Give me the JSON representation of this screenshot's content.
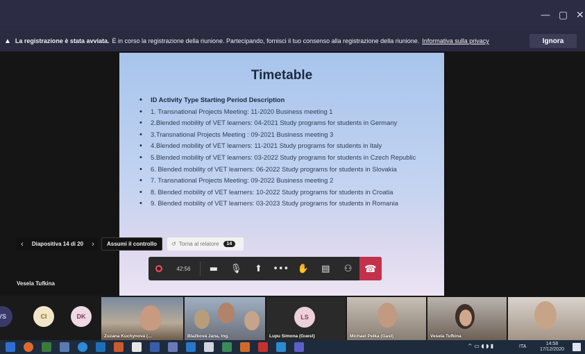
{
  "window": {
    "controls": [
      "—",
      "▢",
      "✕"
    ]
  },
  "banner": {
    "bold_text": "La registrazione è stata avviata.",
    "text": "È in corso la registrazione della riunione. Partecipando, fornisci il tuo consenso alla registrazione della riunione.",
    "link": "Informativa sulla privacy",
    "dismiss_label": "Ignora"
  },
  "slide": {
    "title": "Timetable",
    "items": [
      "ID Activity Type                        Starting Period  Description",
      "1. Transnational Projects Meeting:        11-2020 Business meeting 1",
      "2.Blended mobility of VET learners:     04-2021 Study programs for students in Germany",
      "3.Transnational Projects Meeting :      09-2021 Business meeting 3",
      "4.Blended mobility of VET learners:     11-2021 Study programs for students in Italy",
      "5.Blended mobility of VET learners:     03-2022 Study programs for students in Czech Republic",
      "6. Blended mobility of VET learners:     06-2022 Study programs for students in Slovakia",
      "7. Transnational Projects Meeting:        09-2022 Business meeting 2",
      "8. Blended mobility of VET learners:     10-2022 Study programs for students in Croatia",
      "9. Blended mobility of VET learners:     03-2023 Study programs for students in Romania"
    ]
  },
  "slide_nav": {
    "prev": "‹",
    "label": "Diapositiva 14 di 20",
    "next": "›",
    "take_control": "Assumi il controllo",
    "lower_hand": "Torna al relatore",
    "lower_hand_badge": "14"
  },
  "presenter": {
    "name": "Vesela Tufkina"
  },
  "callbar": {
    "timer": "42:56",
    "icons": [
      "camera-icon",
      "microphone-icon",
      "share-screen-icon",
      "more-icon",
      "raise-hand-icon",
      "chat-icon",
      "participants-icon",
      "hang-up-icon"
    ],
    "hang_up_color": "#c4314b"
  },
  "participants": {
    "avatars": [
      {
        "initials": "VS",
        "bg": "#3a3a6a",
        "fg": "#c9c9f0"
      },
      {
        "initials": "CI",
        "bg": "#f3e6c8",
        "fg": "#8a6a2a"
      },
      {
        "initials": "DK",
        "bg": "#eed9e4",
        "fg": "#7a3b5a"
      },
      {
        "initials": "LS",
        "bg": "#ecd0da",
        "fg": "#8a3b57"
      }
    ],
    "tiles": [
      {
        "name": "Zuzana Kuchynová (..."
      },
      {
        "name": "Blažková Jana, Ing."
      },
      {
        "name": "Lupu Simona (Guest)"
      },
      {
        "name": "Michael Pelka (Gast)"
      },
      {
        "name": "Vesela Tufkina"
      }
    ]
  },
  "taskbar": {
    "time": "14:58",
    "date": "17/12/2020",
    "language": "ITA"
  }
}
